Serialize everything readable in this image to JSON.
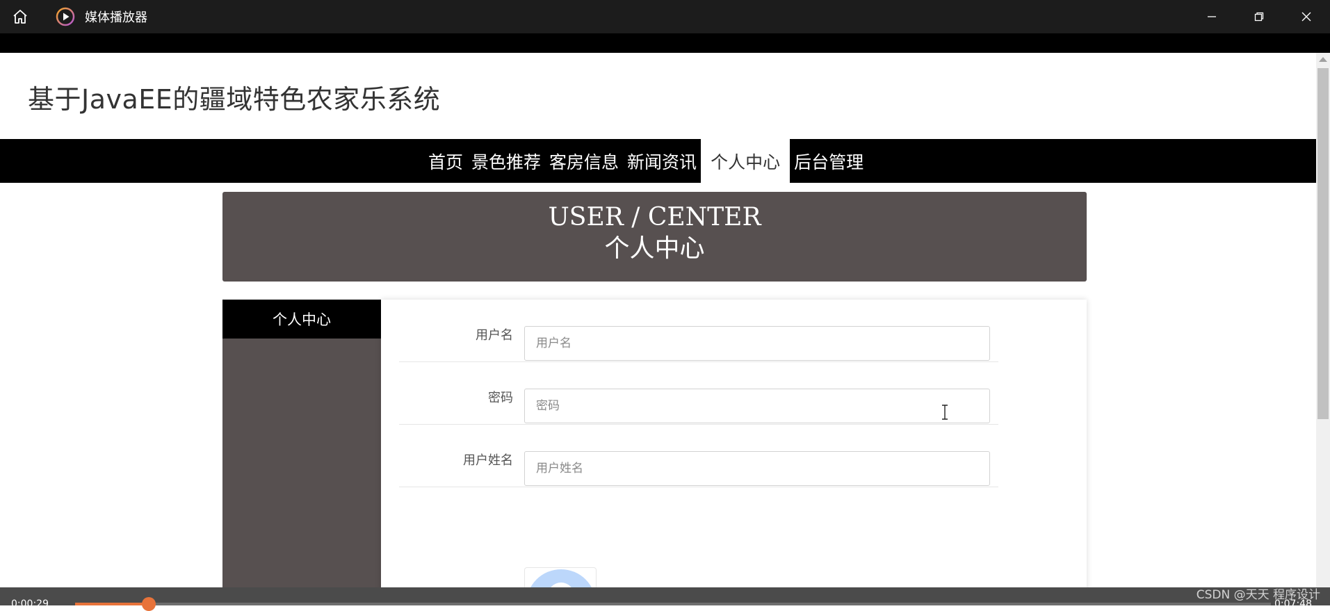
{
  "window": {
    "app_title": "媒体播放器",
    "icons": {
      "home": "home-icon",
      "logo": "play-circle-icon",
      "minimize": "minimize-icon",
      "restore": "restore-icon",
      "close": "close-icon"
    }
  },
  "site": {
    "title": "基于JavaEE的疆域特色农家乐系统"
  },
  "nav": {
    "items": [
      {
        "label": "首页",
        "active": false
      },
      {
        "label": "景色推荐",
        "active": false
      },
      {
        "label": "客房信息",
        "active": false
      },
      {
        "label": "新闻资讯",
        "active": false
      },
      {
        "label": "个人中心",
        "active": true
      },
      {
        "label": "后台管理",
        "active": false
      }
    ]
  },
  "banner": {
    "en": "USER / CENTER",
    "cn": "个人中心"
  },
  "sidebar": {
    "heading": "个人中心"
  },
  "form": {
    "rows": [
      {
        "label": "用户名",
        "placeholder": "用户名",
        "value": ""
      },
      {
        "label": "密码",
        "placeholder": "密码",
        "value": ""
      },
      {
        "label": "用户姓名",
        "placeholder": "用户姓名",
        "value": ""
      }
    ],
    "avatar_icon": "user-avatar-icon"
  },
  "media": {
    "elapsed": "0:00:29",
    "total": "0:07:48",
    "progress": 0.0619,
    "accent": "#e8733a"
  },
  "watermark": "CSDN @天天 程序设计",
  "colors": {
    "nav_bg": "#000000",
    "banner_bg": "#575050",
    "sidebar_bg": "#575050"
  }
}
